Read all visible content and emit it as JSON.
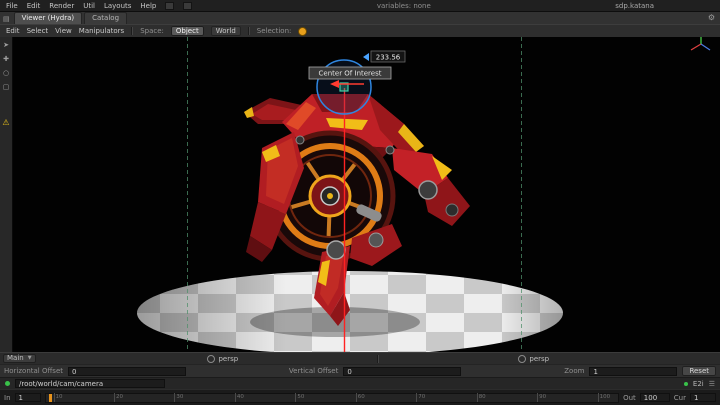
{
  "menubar": {
    "items": [
      "File",
      "Edit",
      "Render",
      "Util",
      "Layouts",
      "Help"
    ],
    "variables": "variables: none",
    "title": "sdp.katana"
  },
  "pane": {
    "tabs": [
      "Viewer (Hydra)",
      "Catalog"
    ]
  },
  "toolbar": {
    "menus": [
      "Edit",
      "Select",
      "View",
      "Manipulators"
    ],
    "space_label": "Space:",
    "object": "Object",
    "world": "World",
    "selection_label": "Selection:"
  },
  "viewport": {
    "coi_tooltip": "Center Of Interest",
    "coi_value": "233.56"
  },
  "view_controls": {
    "layout": "Main",
    "left_camera": "persp",
    "right_camera": "persp"
  },
  "offsets": {
    "horizontal_label": "Horizontal Offset",
    "horizontal_value": "0",
    "vertical_label": "Vertical Offset",
    "vertical_value": "0",
    "zoom_label": "Zoom",
    "zoom_value": "1",
    "reset": "Reset"
  },
  "statusbar": {
    "path": "/root/world/cam/camera",
    "indicator": "E2i"
  },
  "timeline": {
    "in_label": "In",
    "in_value": "1",
    "ticks": [
      "10",
      "20",
      "30",
      "40",
      "50",
      "60",
      "70",
      "80",
      "90",
      "100"
    ],
    "out_label": "Out",
    "out_value": "100",
    "cur_label": "Cur",
    "cur_value": "1"
  },
  "colors": {
    "selection_swatch": "#e8a01c",
    "guide_line": "#4f8f6a",
    "manipulator_blue": "#2f86e0",
    "axis_line_red": "#ff2222"
  }
}
